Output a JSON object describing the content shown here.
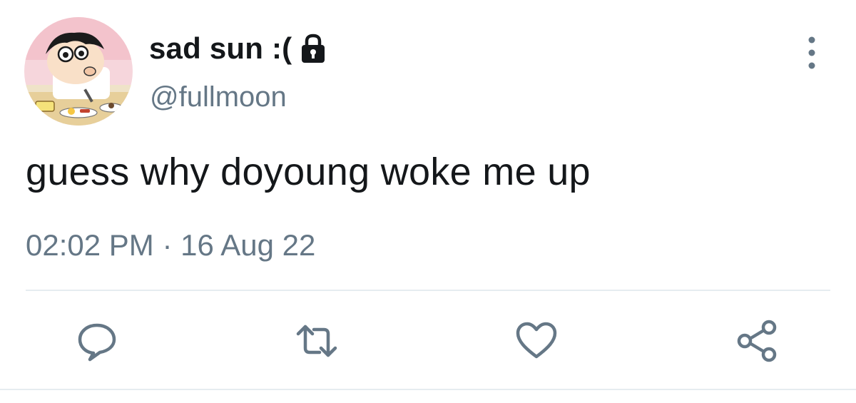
{
  "tweet": {
    "author": {
      "display_name": "sad sun :(",
      "handle": "@fullmoon",
      "protected_icon": "lock-icon",
      "avatar": "cartoon-boy-avatar"
    },
    "text": "guess why doyoung woke me up",
    "time": "02:02 PM",
    "separator": "·",
    "date": "16 Aug 22"
  },
  "actions": [
    {
      "name": "reply",
      "icon": "reply-icon"
    },
    {
      "name": "retweet",
      "icon": "retweet-icon"
    },
    {
      "name": "like",
      "icon": "heart-icon"
    },
    {
      "name": "share",
      "icon": "share-icon"
    }
  ],
  "menu_icon": "more-vertical-icon",
  "colors": {
    "text_primary": "#14171a",
    "text_secondary": "#657786",
    "divider": "#e6ecf0"
  }
}
